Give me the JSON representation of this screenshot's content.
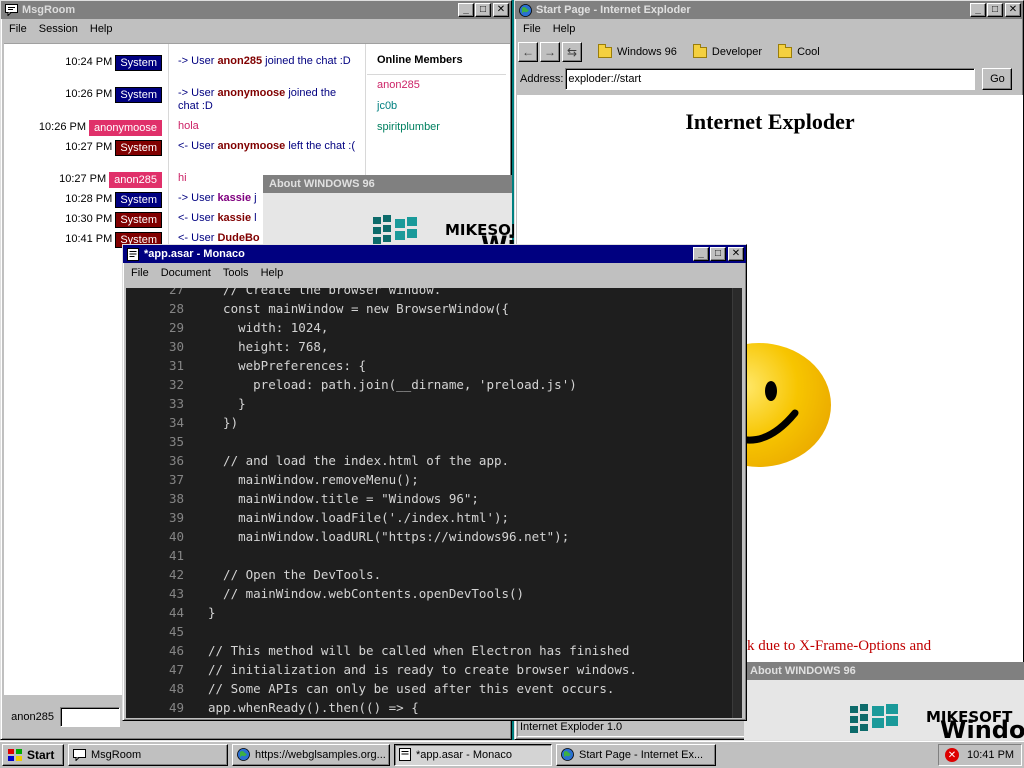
{
  "msgroom": {
    "title": "MsgRoom",
    "menu": [
      "File",
      "Session",
      "Help"
    ],
    "messages": [
      {
        "time": "10:24 PM",
        "user": "System",
        "style": "system-blue",
        "pre": "-> User ",
        "name": "anon285",
        "post": " joined the chat :D"
      },
      {
        "time": "10:26 PM",
        "user": "System",
        "style": "system-blue",
        "pre": "-> User ",
        "name": "anonymoose",
        "post": " joined the chat :D"
      },
      {
        "time": "10:26 PM",
        "user": "anonymoose",
        "style": "pink",
        "pre": "hola",
        "name": "",
        "post": ""
      },
      {
        "time": "10:27 PM",
        "user": "System",
        "style": "system-red",
        "pre": "<- User ",
        "name": "anonymoose",
        "post": " left the chat :("
      },
      {
        "time": "10:27 PM",
        "user": "anon285",
        "style": "pink",
        "pre": "hi",
        "name": "",
        "post": ""
      },
      {
        "time": "10:28 PM",
        "user": "System",
        "style": "system-blue",
        "pre": "-> User ",
        "name": "kassie",
        "post": " j"
      },
      {
        "time": "10:30 PM",
        "user": "System",
        "style": "system-red",
        "pre": "<- User ",
        "name": "kassie",
        "post": " l"
      },
      {
        "time": "10:41 PM",
        "user": "System",
        "style": "system-red",
        "pre": "<- User ",
        "name": "DudeBo",
        "post": ""
      }
    ],
    "members_title": "Online Members",
    "members": [
      {
        "name": "anon285",
        "color": "#cc2266"
      },
      {
        "name": "jc0b",
        "color": "#008080"
      },
      {
        "name": "spiritplumber",
        "color": "#008060"
      }
    ],
    "nick": "anon285"
  },
  "about": {
    "title": "About WINDOWS 96",
    "brand": "MIKESOFT",
    "brand_short": "Wi",
    "brand_long": "Windo"
  },
  "iexp": {
    "title": "Start Page - Internet Exploder",
    "menu": [
      "File",
      "Help"
    ],
    "favorites": [
      "Windows 96",
      "Developer",
      "Cool"
    ],
    "address_label": "Address:",
    "address": "exploder://start",
    "go": "Go",
    "heading": "Internet Exploder",
    "blocked_msg": "k due to X-Frame-Options and",
    "status": "Internet Exploder 1.0"
  },
  "monaco": {
    "title": "*app.asar - Monaco",
    "menu": [
      "File",
      "Document",
      "Tools",
      "Help"
    ],
    "lines": [
      {
        "n": "27",
        "code": "  // Create the browser window."
      },
      {
        "n": "28",
        "code": "  const mainWindow = new BrowserWindow({"
      },
      {
        "n": "29",
        "code": "    width: 1024,"
      },
      {
        "n": "30",
        "code": "    height: 768,"
      },
      {
        "n": "31",
        "code": "    webPreferences: {"
      },
      {
        "n": "32",
        "code": "      preload: path.join(__dirname, 'preload.js')"
      },
      {
        "n": "33",
        "code": "    }"
      },
      {
        "n": "34",
        "code": "  })"
      },
      {
        "n": "35",
        "code": ""
      },
      {
        "n": "36",
        "code": "  // and load the index.html of the app."
      },
      {
        "n": "37",
        "code": "    mainWindow.removeMenu();"
      },
      {
        "n": "38",
        "code": "    mainWindow.title = \"Windows 96\";"
      },
      {
        "n": "39",
        "code": "    mainWindow.loadFile('./index.html');"
      },
      {
        "n": "40",
        "code": "    mainWindow.loadURL(\"https://windows96.net\");"
      },
      {
        "n": "41",
        "code": ""
      },
      {
        "n": "42",
        "code": "  // Open the DevTools."
      },
      {
        "n": "43",
        "code": "  // mainWindow.webContents.openDevTools()"
      },
      {
        "n": "44",
        "code": "}"
      },
      {
        "n": "45",
        "code": ""
      },
      {
        "n": "46",
        "code": "// This method will be called when Electron has finished"
      },
      {
        "n": "47",
        "code": "// initialization and is ready to create browser windows."
      },
      {
        "n": "48",
        "code": "// Some APIs can only be used after this event occurs."
      },
      {
        "n": "49",
        "code": "app.whenReady().then(() => {"
      }
    ]
  },
  "taskbar": {
    "start": "Start",
    "tasks": [
      "MsgRoom",
      "https://webglsamples.org...",
      "*app.asar - Monaco",
      "Start Page - Internet Ex..."
    ],
    "time": "10:41 PM"
  }
}
